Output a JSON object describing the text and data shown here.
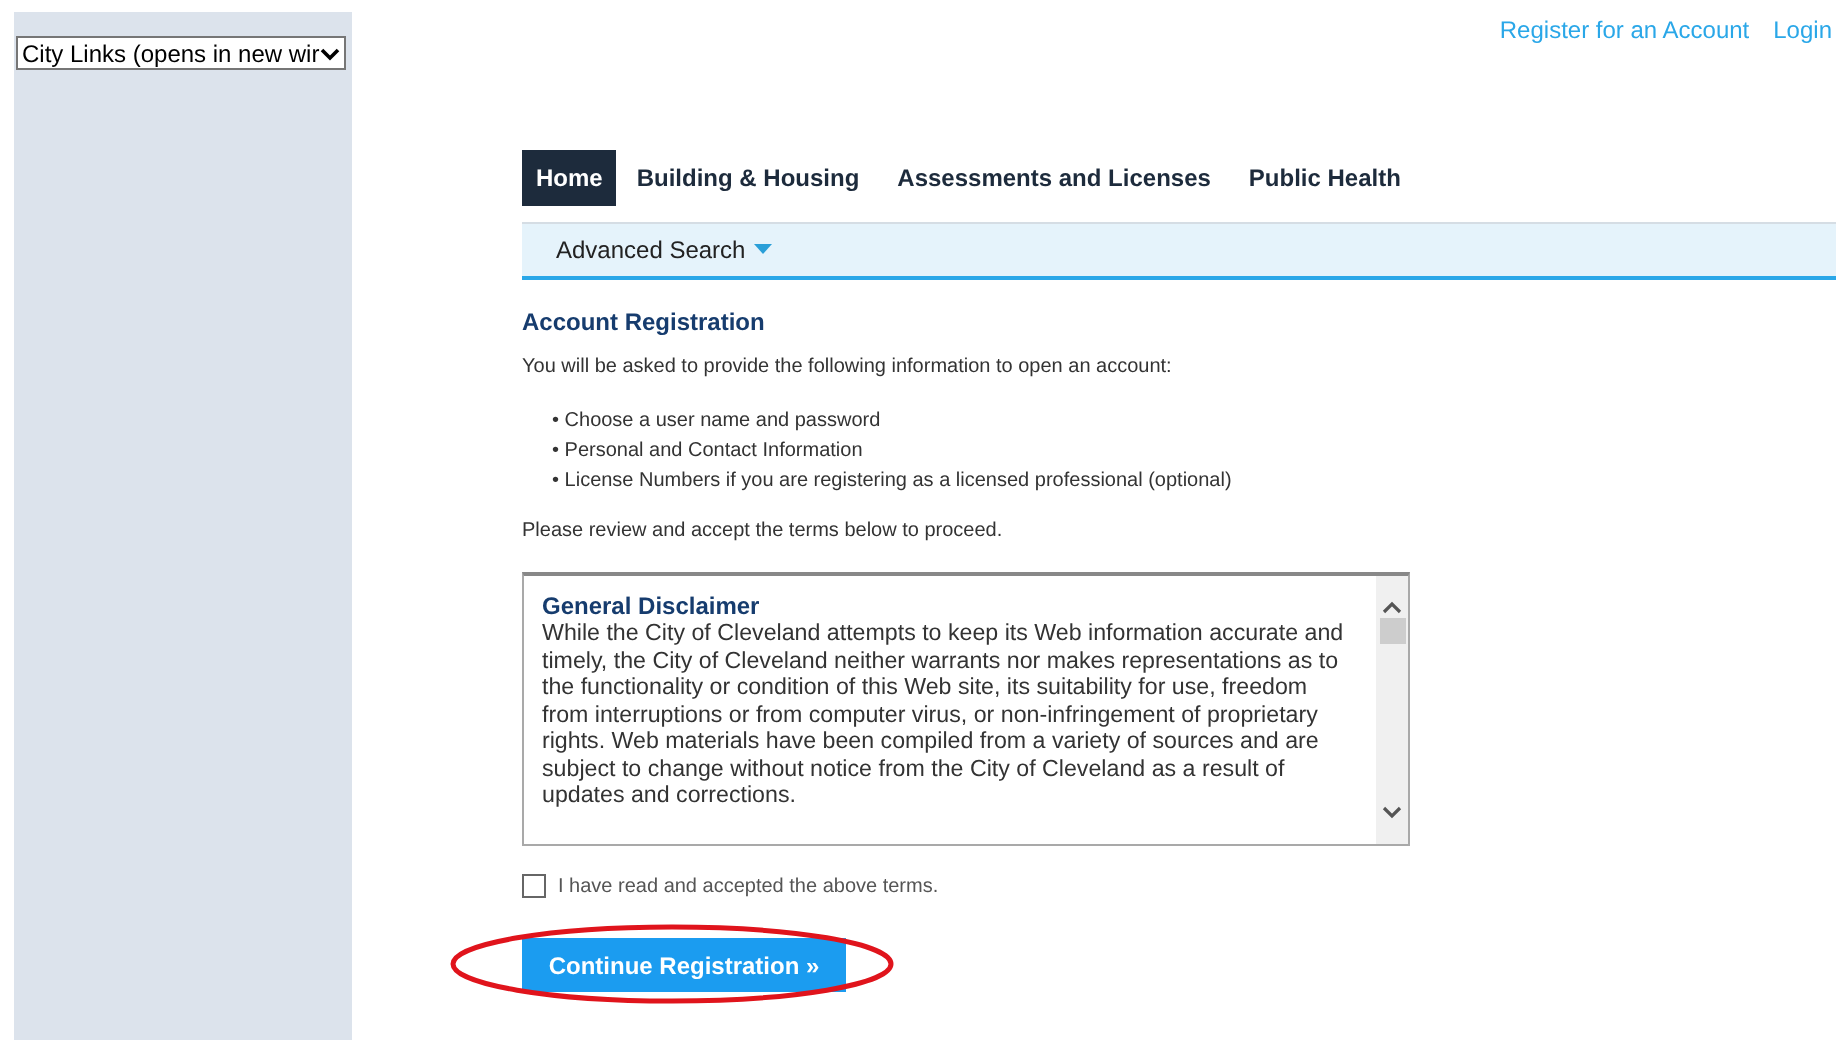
{
  "city_links": {
    "value": "City Links (opens in new wir"
  },
  "top_links": [
    "Register for an Account",
    "Login"
  ],
  "tabs": [
    {
      "label": "Home",
      "selected": true
    },
    {
      "label": "Building & Housing",
      "selected": false
    },
    {
      "label": "Assessments and Licenses",
      "selected": false
    },
    {
      "label": "Public Health",
      "selected": false
    }
  ],
  "subnav": {
    "label": "Advanced Search"
  },
  "heading": "Account Registration",
  "intro": "You will be asked to provide the following information to open an account:",
  "bullets": [
    "• Choose a user name and password",
    "• Personal and Contact Information",
    "• License Numbers if you are registering as a licensed professional (optional)"
  ],
  "review_note": "Please review and accept the terms below to proceed.",
  "terms": {
    "title": "General Disclaimer",
    "body": "While the City of Cleveland attempts to keep its Web information accurate and timely, the City of Cleveland neither warrants nor makes representations as to the functionality or condition of this Web site, its suitability for use, freedom from interruptions or from computer virus, or non-infringement of proprietary rights. Web materials have been compiled from a variety of sources and are subject to change without notice from the City of Cleveland as a result of updates and corrections."
  },
  "accept": {
    "label": "I have read and accepted the above terms.",
    "checked": false
  },
  "continue_button": {
    "label": "Continue Registration »",
    "highlighted": true
  }
}
